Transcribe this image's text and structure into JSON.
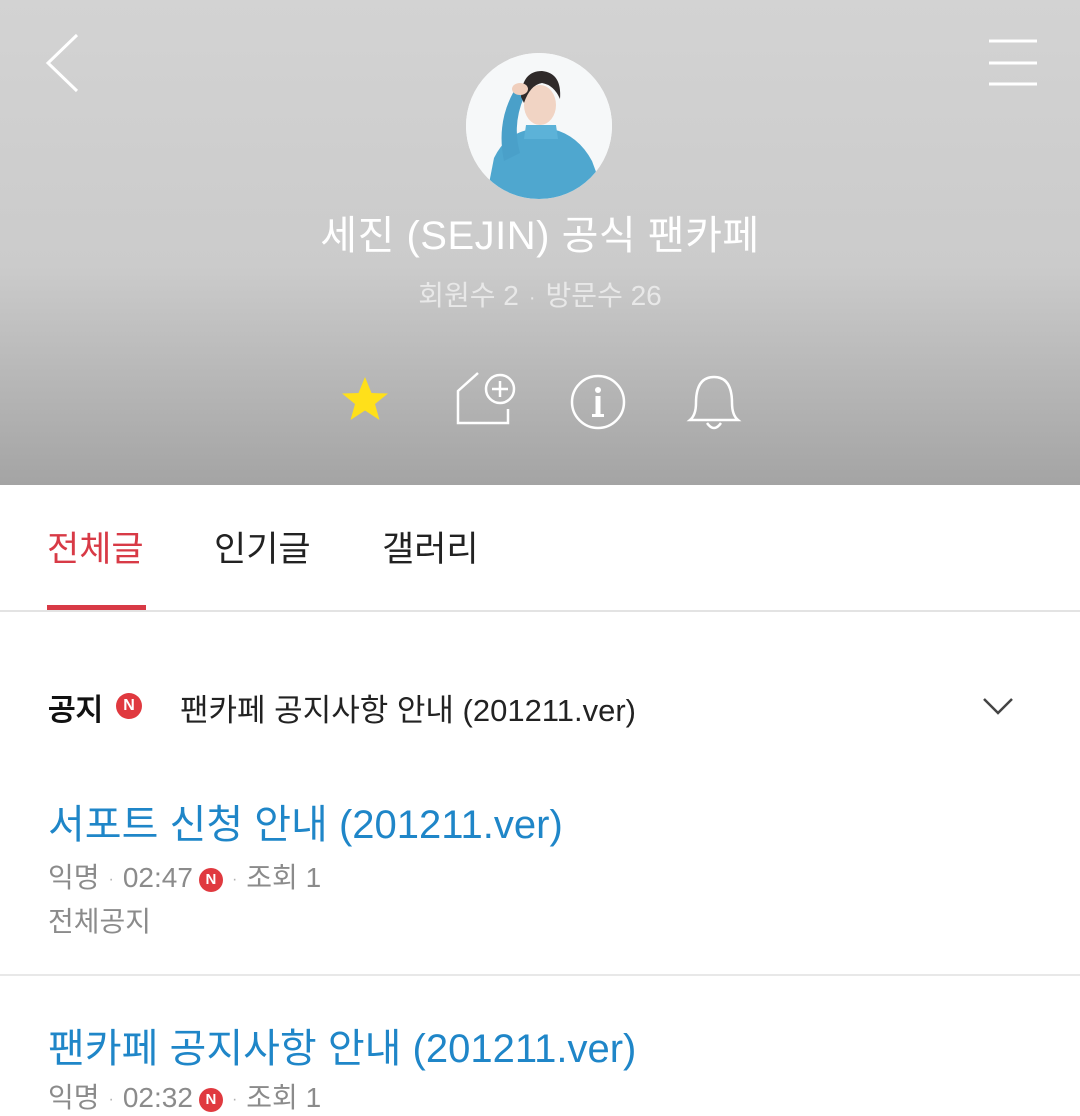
{
  "header": {
    "cafe_name": "세진 (SEJIN) 공식 팬카페",
    "members": "회원수 2",
    "dot": "·",
    "visits": "방문수 26",
    "icons": [
      "back-arrow-icon",
      "menu-icon",
      "star-icon",
      "home-add-icon",
      "info-icon",
      "bell-icon"
    ],
    "star_color": "#ffe01a"
  },
  "tabs": [
    {
      "label": "전체글",
      "active": true
    },
    {
      "label": "인기글",
      "active": false
    },
    {
      "label": "갤러리",
      "active": false
    }
  ],
  "notice": {
    "label": "공지",
    "badge": "N",
    "text": "팬카페 공지사항 안내 (201211.ver)"
  },
  "posts": [
    {
      "title": "서포트 신청 안내 (201211.ver)",
      "author": "익명",
      "time": "02:47",
      "badge": "N",
      "views": "조회 1",
      "category": "전체공지"
    },
    {
      "title": "팬카페 공지사항 안내 (201211.ver)",
      "author": "익명",
      "time": "02:32",
      "badge": "N",
      "views": "조회 1"
    }
  ],
  "colors": {
    "accent_red": "#d83a46",
    "link_blue": "#1f86c8",
    "badge_red": "#e0393f"
  }
}
